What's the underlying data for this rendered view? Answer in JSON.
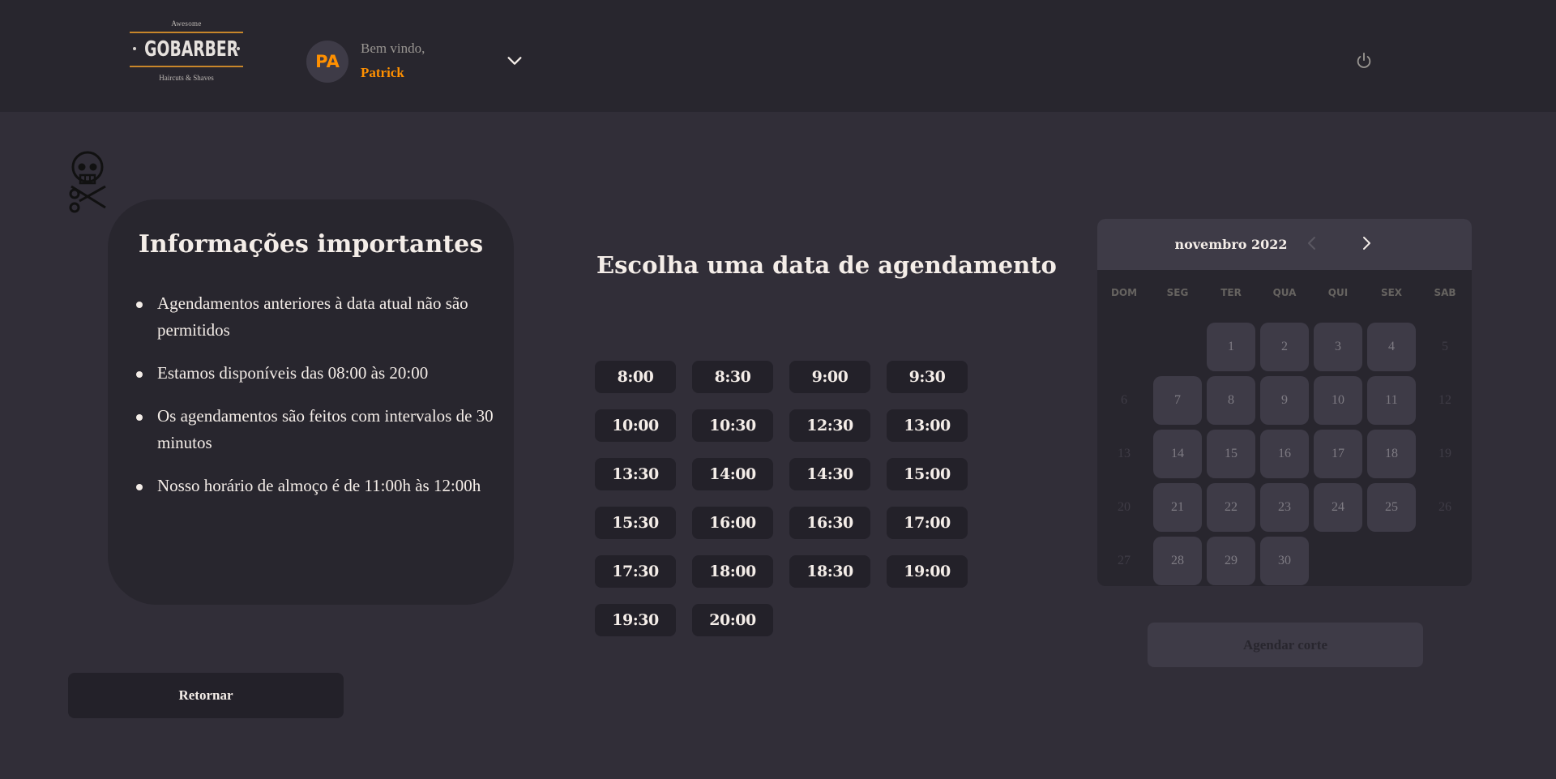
{
  "header": {
    "logo": {
      "top": "Awesome",
      "brand": "GOBARBER",
      "bottom": "Haircuts & Shaves"
    },
    "avatar_initials": "PA",
    "welcome": "Bem vindo,",
    "username": "Patrick"
  },
  "info": {
    "title": "Informações importantes",
    "items": [
      "Agendamentos anteriores à data atual não são permitidos",
      "Estamos disponíveis das 08:00 às 20:00",
      "Os agendamentos são feitos com intervalos de 30 minutos",
      "Nosso horário de almoço é de 11:00h às 12:00h"
    ]
  },
  "return_button": "Retornar",
  "times": {
    "title": "Escolha uma data de agendamento",
    "slots": [
      "8:00",
      "8:30",
      "9:00",
      "9:30",
      "10:00",
      "10:30",
      "12:30",
      "13:00",
      "13:30",
      "14:00",
      "14:30",
      "15:00",
      "15:30",
      "16:00",
      "16:30",
      "17:00",
      "17:30",
      "18:00",
      "18:30",
      "19:00",
      "19:30",
      "20:00"
    ]
  },
  "calendar": {
    "month": "novembro 2022",
    "weekdays": [
      "DOM",
      "SEG",
      "TER",
      "QUA",
      "QUI",
      "SEX",
      "SAB"
    ],
    "leading_blanks": 2,
    "days": [
      {
        "n": "1",
        "avail": true
      },
      {
        "n": "2",
        "avail": true
      },
      {
        "n": "3",
        "avail": true
      },
      {
        "n": "4",
        "avail": true
      },
      {
        "n": "5",
        "avail": false
      },
      {
        "n": "6",
        "avail": false
      },
      {
        "n": "7",
        "avail": true
      },
      {
        "n": "8",
        "avail": true
      },
      {
        "n": "9",
        "avail": true
      },
      {
        "n": "10",
        "avail": true
      },
      {
        "n": "11",
        "avail": true
      },
      {
        "n": "12",
        "avail": false
      },
      {
        "n": "13",
        "avail": false
      },
      {
        "n": "14",
        "avail": true
      },
      {
        "n": "15",
        "avail": true
      },
      {
        "n": "16",
        "avail": true
      },
      {
        "n": "17",
        "avail": true
      },
      {
        "n": "18",
        "avail": true
      },
      {
        "n": "19",
        "avail": false
      },
      {
        "n": "20",
        "avail": false
      },
      {
        "n": "21",
        "avail": true
      },
      {
        "n": "22",
        "avail": true
      },
      {
        "n": "23",
        "avail": true
      },
      {
        "n": "24",
        "avail": true
      },
      {
        "n": "25",
        "avail": true
      },
      {
        "n": "26",
        "avail": false
      },
      {
        "n": "27",
        "avail": false
      },
      {
        "n": "28",
        "avail": true
      },
      {
        "n": "29",
        "avail": true
      },
      {
        "n": "30",
        "avail": true
      }
    ]
  },
  "schedule_button": "Agendar corte",
  "colors": {
    "accent": "#ff9000",
    "background": "#312e38",
    "surface": "#28262e",
    "input": "#232129",
    "shape": "#3e3b47"
  }
}
